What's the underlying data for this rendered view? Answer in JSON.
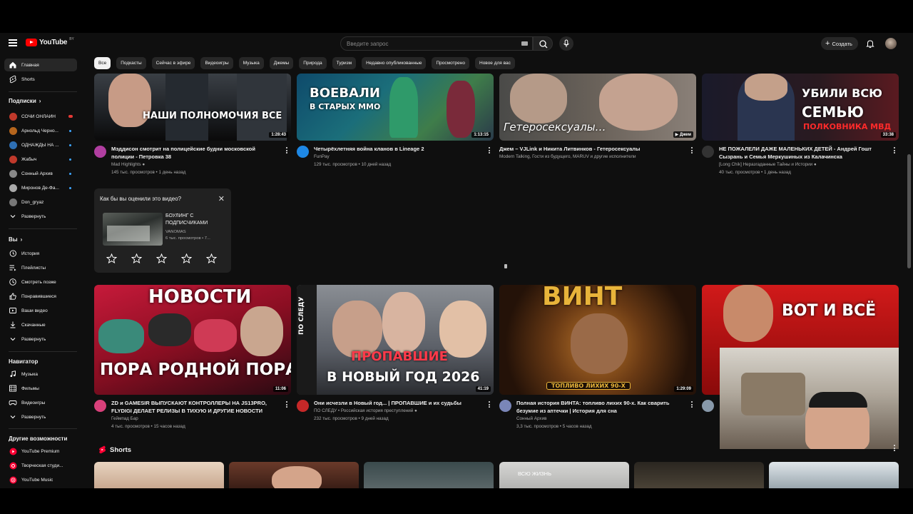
{
  "header": {
    "logo_text": "YouTube",
    "logo_country": "BY",
    "search_placeholder": "Введите запрос",
    "create_label": "Создать"
  },
  "sidebar": {
    "main": [
      {
        "label": "Главная",
        "icon": "home-icon",
        "active": true
      },
      {
        "label": "Shorts",
        "icon": "shorts-icon",
        "active": false
      }
    ],
    "subs_heading": "Подписки",
    "subs": [
      {
        "label": "СОЧИ ОНЛАЙН",
        "color": "#c0392b",
        "badge": "live"
      },
      {
        "label": "Арнольд Черно...",
        "color": "#b5651d",
        "badge": "dot"
      },
      {
        "label": "ОДНАЖДЫ НА ...",
        "color": "#2e6fb4",
        "badge": "dot"
      },
      {
        "label": "Жабыч",
        "color": "#c0392b",
        "badge": "dot"
      },
      {
        "label": "Сонный Архив",
        "color": "#888888",
        "badge": "dot"
      },
      {
        "label": "Миронов Де-Фа...",
        "color": "#aaaaaa",
        "badge": "dot"
      },
      {
        "label": "Don_gryaz",
        "color": "#777777",
        "badge": "none"
      }
    ],
    "subs_expand": "Развернуть",
    "you_heading": "Вы",
    "you": [
      {
        "label": "История",
        "icon": "history-icon"
      },
      {
        "label": "Плейлисты",
        "icon": "playlists-icon"
      },
      {
        "label": "Смотреть позже",
        "icon": "watch-later-icon"
      },
      {
        "label": "Понравившиеся",
        "icon": "like-icon"
      },
      {
        "label": "Ваши видео",
        "icon": "your-videos-icon"
      },
      {
        "label": "Скачанные",
        "icon": "download-icon"
      },
      {
        "label": "Развернуть",
        "icon": "chevron-down-icon"
      }
    ],
    "nav_heading": "Навигатор",
    "nav": [
      {
        "label": "Музыка",
        "icon": "music-icon"
      },
      {
        "label": "Фильмы",
        "icon": "film-icon"
      },
      {
        "label": "Видеоигры",
        "icon": "gamepad-icon"
      },
      {
        "label": "Развернуть",
        "icon": "chevron-down-icon"
      }
    ],
    "more_heading": "Другие возможности",
    "more": [
      {
        "label": "YouTube Premium",
        "icon": "premium-icon"
      },
      {
        "label": "Творческая студи...",
        "icon": "studio-icon"
      },
      {
        "label": "YouTube Music",
        "icon": "yt-music-icon"
      }
    ]
  },
  "chips": [
    "Все",
    "Подкасты",
    "Сейчас в эфире",
    "Видеоигры",
    "Музыка",
    "Джемы",
    "Природа",
    "Туризм",
    "Недавно опубликованные",
    "Просмотрено",
    "Новое для вас"
  ],
  "videos_row1": [
    {
      "title": "Мэддисон смотрит на полицейские будни московской полиции - Петровка 38",
      "channel": "Mad Highlights",
      "verified": true,
      "stats": "145 тыс. просмотров • 1 день назад",
      "duration": "1:28:43",
      "thumb_text": "НАШИ ПОЛНОМОЧИЯ ВСЕ",
      "avatar_color": "#b03ea0"
    },
    {
      "title": "Четырёхлетняя война кланов в Lineage 2",
      "channel": "FunPay",
      "verified": false,
      "stats": "129 тыс. просмотров • 10 дней назад",
      "duration": "1:13:15",
      "thumb_text_1": "ВОЕВАЛИ",
      "thumb_text_2": "В СТАРЫХ ММО",
      "avatar_color": "#1e88e5"
    },
    {
      "title": "Джем – VJLink и Никита Литвинков - Гетеросексуалы",
      "channel": "Modern Talking, Гости из будущего, MARUV и другие исполнители",
      "verified": false,
      "stats": "",
      "duration": "Джем",
      "thumb_text": "Гетеросексуалы…",
      "avatar_color": ""
    },
    {
      "title": "НЕ ПОЖАЛЕЛИ ДАЖЕ МАЛЕНЬКИХ ДЕТЕЙ - Андрей Гошт Сызрань и Семья Меркушиных из Калачинска",
      "channel": "[Long Chik] Неразгаданные Тайны и Истории",
      "verified": true,
      "stats": "40 тыс. просмотров • 1 день назад",
      "duration": "33:38",
      "thumb_text_1": "УБИЛИ ВСЮ",
      "thumb_text_2": "СЕМЬЮ",
      "thumb_text_3": "ПОЛКОВНИКА МВД",
      "avatar_color": "#333333"
    }
  ],
  "survey": {
    "question": "Как бы вы оценили это видео?",
    "video_title": "БОУЛИНГ С ПОДПИСЧИКАМИ",
    "channel": "VANOMAS",
    "stats": "6 тыс. просмотров • 7..."
  },
  "videos_row2": [
    {
      "title": "ZD и GAMESIR ВЫПУСКАЮТ КОНТРОЛЛЕРЫ НА JS13PRO, FLYDIGI ДЕЛАЕТ РЕЛИЗЫ В ТИХУЮ И ДРУГИЕ НОВОСТИ",
      "channel": "Геймпад Бар",
      "verified": false,
      "stats": "4 тыс. просмотров • 15 часов назад",
      "duration": "11:06",
      "thumb_text_1": "НОВОСТИ",
      "thumb_text_2": "ПОРА РОДНОЙ ПОРА",
      "avatar_color": "#d8407a"
    },
    {
      "title": "Они исчезли в Новый год... | ПРОПАВШИЕ и их судьбы",
      "channel": "ПО СЛЕДУ • Российская история преступлений",
      "verified": true,
      "stats": "232 тыс. просмотров • 9 дней назад",
      "duration": "41:19",
      "thumb_text_1": "ПРОПАВШИЕ",
      "thumb_text_2": "В НОВЫЙ ГОД 2026",
      "thumb_text_3": "ПО СЛЕДУ",
      "avatar_color": "#c62828"
    },
    {
      "title": "Полная история ВИНТА: топливо лихих 90-х. Как сварить безумие из аптечки | История для сна",
      "channel": "Сонный Архив",
      "verified": false,
      "stats": "3,3 тыс. просмотров • 5 часов назад",
      "duration": "1:29:09",
      "thumb_text_1": "ВИНТ",
      "thumb_text_2": "ТОПЛИВО ЛИХИХ 90-Х",
      "avatar_color": "#7a86b8"
    },
    {
      "title": "",
      "channel": "",
      "verified": false,
      "stats": "",
      "duration": "",
      "thumb_text_1": "ВОТ И ВСЁ",
      "avatar_color": "#8899aa"
    }
  ],
  "shorts": {
    "heading": "Shorts",
    "thumb_text": "ВСЮ ЖИЗНЬ"
  }
}
